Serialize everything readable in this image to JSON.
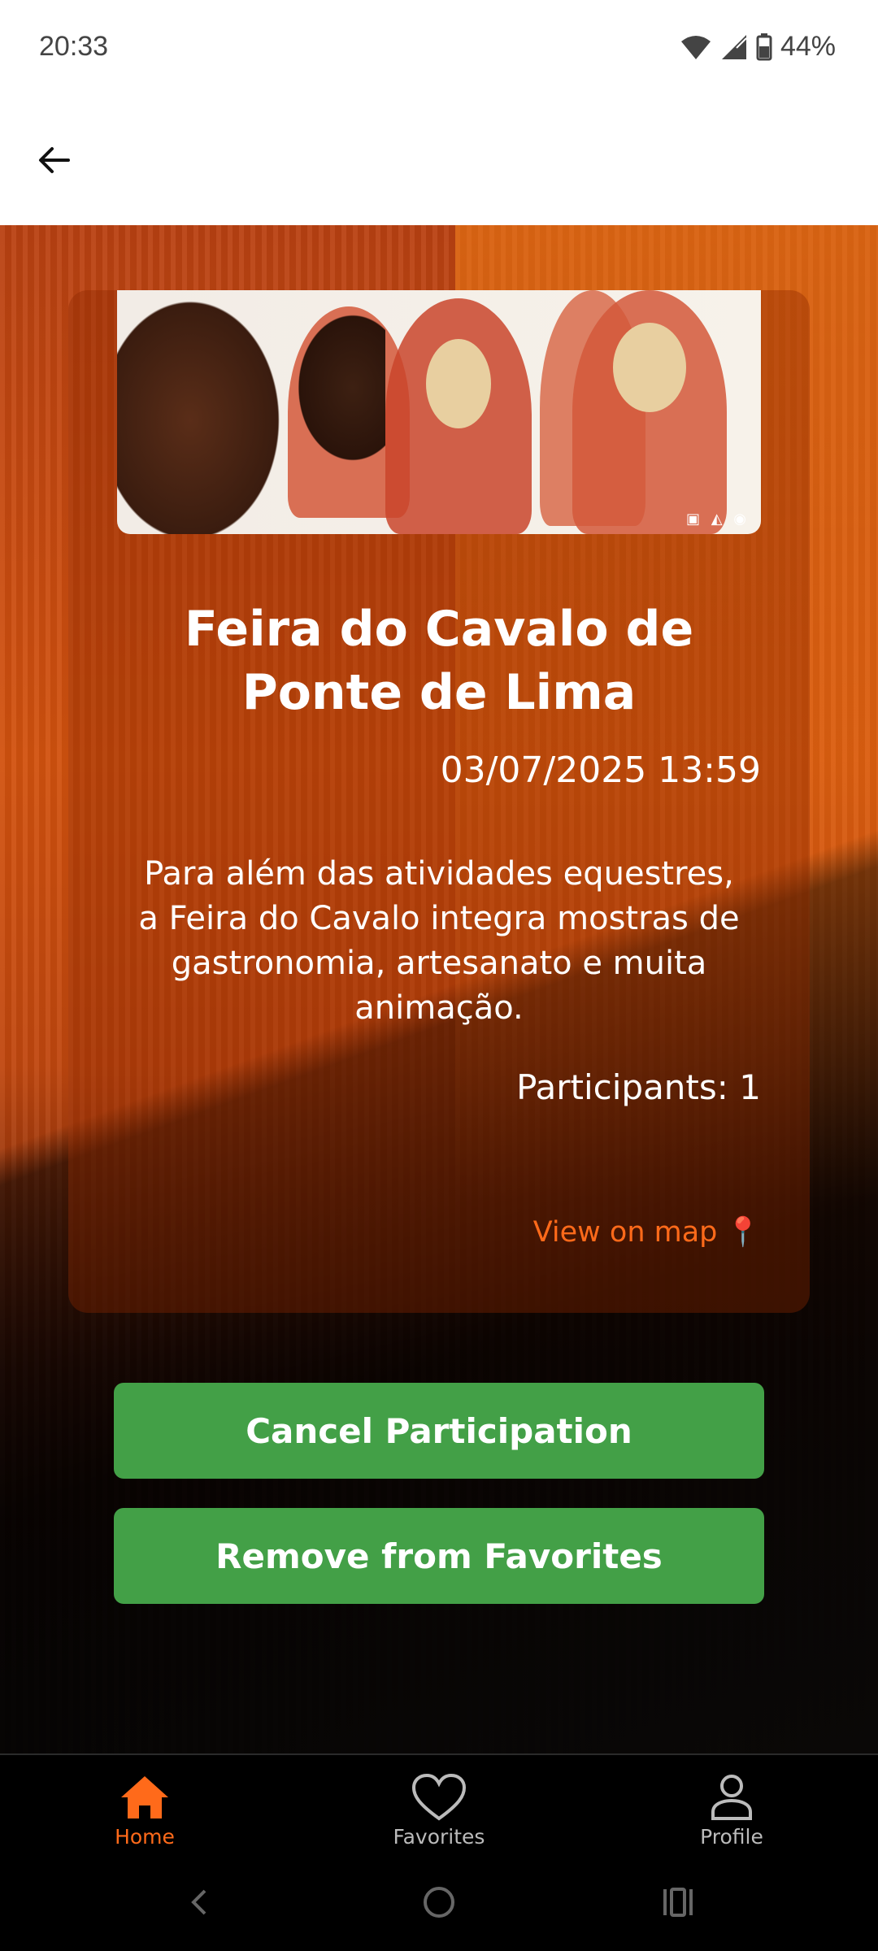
{
  "status_bar": {
    "time": "20:33",
    "battery": "44%"
  },
  "event": {
    "title": "Feira do Cavalo de Ponte de Lima",
    "datetime": "03/07/2025 13:59",
    "description": "Para além das atividades equestres, a Feira do Cavalo integra mostras de gastronomia, artesanato e muita animação.",
    "participants": "Participants: 1",
    "map_link": "View on map"
  },
  "actions": {
    "cancel_label": "Cancel Participation",
    "favorite_label": "Remove from Favorites"
  },
  "bottom_nav": {
    "items": [
      {
        "label": "Home",
        "icon": "home-icon",
        "active": true
      },
      {
        "label": "Favorites",
        "icon": "heart-icon",
        "active": false
      },
      {
        "label": "Profile",
        "icon": "person-icon",
        "active": false
      }
    ]
  },
  "colors": {
    "accent": "#ff6a1a",
    "button": "#43a047"
  }
}
